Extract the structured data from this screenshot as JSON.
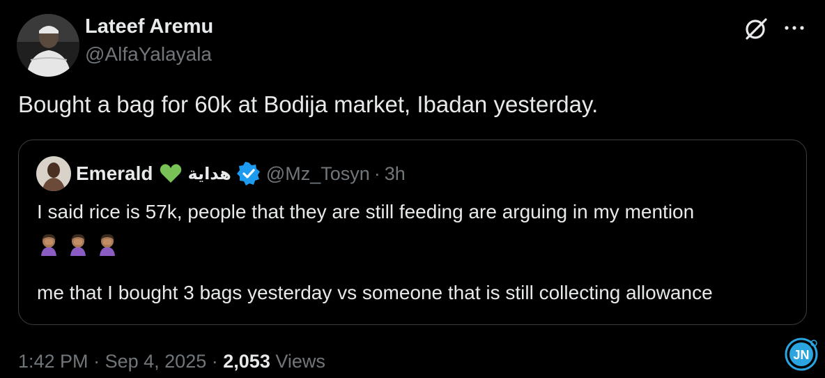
{
  "tweet": {
    "author": {
      "name": "Lateef Aremu",
      "handle": "@AlfaYalayala"
    },
    "text": "Bought a bag for 60k at Bodija market, Ibadan yesterday.",
    "icons": {
      "grok": "grok-icon",
      "more": "more-options-icon"
    },
    "quoted": {
      "name": "Emerald",
      "name_suffix": "هداية",
      "badge_icons": [
        "green-heart-icon",
        "verified-badge-icon"
      ],
      "handle": "@Mz_Tosyn",
      "separator": "·",
      "time": "3h",
      "line1": "I said rice is 57k, people that they are still feeding are arguing in my mention",
      "emojis": [
        "woman-facepalming-icon",
        "woman-facepalming-icon",
        "woman-facepalming-icon"
      ],
      "line2": "me that I bought 3 bags yesterday vs someone that is still collecting allowance"
    },
    "meta": {
      "time": "1:42 PM",
      "sep1": "·",
      "date": "Sep 4, 2025",
      "sep2": "·",
      "views_count": "2,053",
      "views_label": "Views"
    },
    "watermark": "JN"
  },
  "colors": {
    "background": "#000000",
    "text_primary": "#e7e9ea",
    "text_secondary": "#71767b",
    "border": "#3a3f44",
    "verified": "#1d9bf0",
    "heart": "#78c257",
    "watermark": "#2aa5e0"
  }
}
